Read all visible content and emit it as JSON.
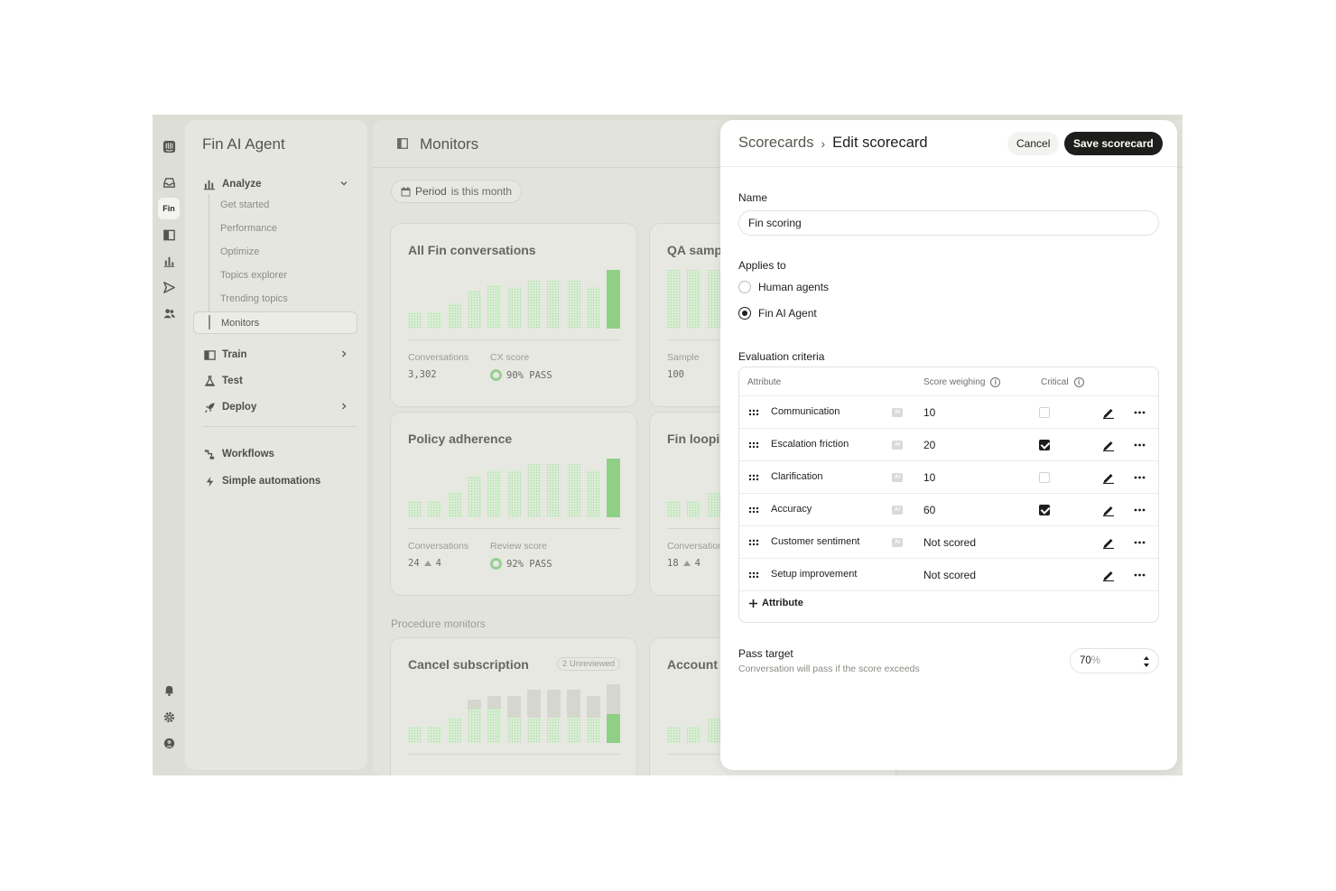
{
  "sidebar": {
    "app_title": "Fin AI Agent",
    "rail_fin_label": "Fin",
    "analyze": "Analyze",
    "sub_items": [
      "Get started",
      "Performance",
      "Optimize",
      "Topics explorer",
      "Trending topics",
      "Monitors"
    ],
    "train": "Train",
    "test": "Test",
    "deploy": "Deploy",
    "workflows": "Workflows",
    "simple_automations": "Simple automations"
  },
  "main": {
    "title": "Monitors",
    "period_label": "Period",
    "period_value": "is this month",
    "section_label": "Procedure monitors",
    "cards": [
      {
        "title": "All Fin conversations",
        "stat1_label": "Conversations",
        "stat1_value": "3,302",
        "stat2_label": "CX score",
        "stat2_value": "90% PASS"
      },
      {
        "title": "QA sampl",
        "stat1_label": "Sample",
        "stat1_value": "100"
      },
      {
        "title": "Policy adherence",
        "stat1_label": "Conversations",
        "stat1_value": "24",
        "stat1_delta": "4",
        "stat2_label": "Review score",
        "stat2_value": "92% PASS"
      },
      {
        "title": "Fin loopin",
        "stat1_label": "Conversation",
        "stat1_value": "18",
        "stat1_delta": "4"
      },
      {
        "title": "Cancel subscription",
        "badge": "2 Unreviewed"
      },
      {
        "title": "Account t"
      }
    ]
  },
  "drawer": {
    "breadcrumb_parent": "Scorecards",
    "breadcrumb_sep": "›",
    "breadcrumb_current": "Edit scorecard",
    "cancel_label": "Cancel",
    "save_label": "Save scorecard",
    "name_label": "Name",
    "name_value": "Fin scoring",
    "applies_label": "Applies to",
    "applies_options": [
      {
        "label": "Human agents",
        "selected": false
      },
      {
        "label": "Fin AI Agent",
        "selected": true
      }
    ],
    "criteria_label": "Evaluation criteria",
    "columns": {
      "attribute": "Attribute",
      "weighing": "Score weighing",
      "critical": "Critical"
    },
    "ai_badge": "AI",
    "rows": [
      {
        "name": "Communication",
        "ai": true,
        "weight": "10",
        "critical": false,
        "has_critical": true
      },
      {
        "name": "Escalation friction",
        "ai": true,
        "weight": "20",
        "critical": true,
        "has_critical": true
      },
      {
        "name": "Clarification",
        "ai": true,
        "weight": "10",
        "critical": false,
        "has_critical": true
      },
      {
        "name": "Accuracy",
        "ai": true,
        "weight": "60",
        "critical": true,
        "has_critical": true
      },
      {
        "name": "Customer sentiment",
        "ai": true,
        "weight": "Not scored",
        "critical": false,
        "has_critical": false
      },
      {
        "name": "Setup improvement",
        "ai": false,
        "weight": "Not scored",
        "critical": false,
        "has_critical": false
      }
    ],
    "add_attribute_label": "Attribute",
    "pass_target_label": "Pass target",
    "pass_target_desc": "Conversation will pass if the score exceeds",
    "pass_target_value": "70",
    "pass_target_unit": "%"
  },
  "colors": {
    "accent_green": "#8fcf86",
    "dark": "#1d1d1b"
  }
}
